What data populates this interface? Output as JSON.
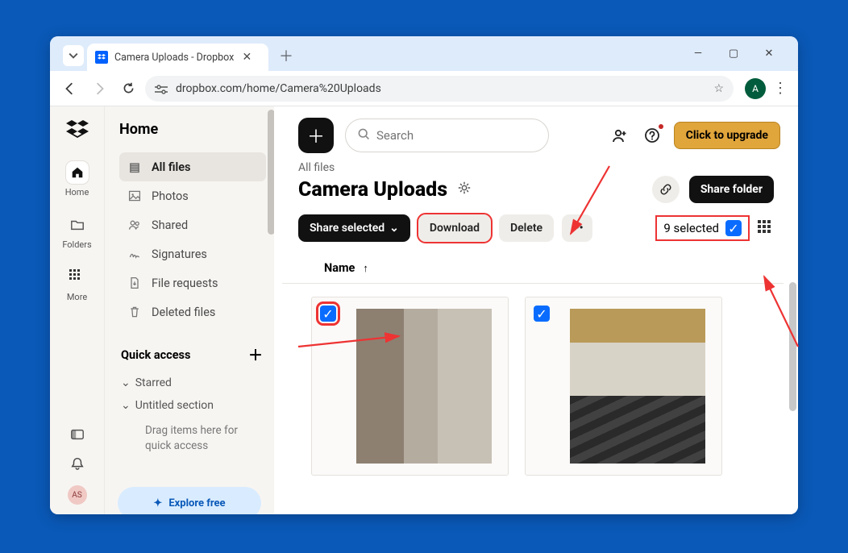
{
  "browser": {
    "tab_title": "Camera Uploads - Dropbox",
    "url": "dropbox.com/home/Camera%20Uploads",
    "profile_initial": "A"
  },
  "rail": {
    "items": [
      {
        "label": "Home"
      },
      {
        "label": "Folders"
      },
      {
        "label": "More"
      }
    ]
  },
  "sidebar": {
    "heading": "Home",
    "items": [
      {
        "label": "All files"
      },
      {
        "label": "Photos"
      },
      {
        "label": "Shared"
      },
      {
        "label": "Signatures"
      },
      {
        "label": "File requests"
      },
      {
        "label": "Deleted files"
      }
    ],
    "quick_access": "Quick access",
    "starred": "Starred",
    "untitled": "Untitled section",
    "drag_hint": "Drag items here for quick access",
    "explore": "Explore free",
    "avatar": "AS"
  },
  "main": {
    "search_placeholder": "Search",
    "upgrade": "Click to upgrade",
    "breadcrumb": "All files",
    "page_title": "Camera Uploads",
    "share_folder": "Share folder",
    "share_selected": "Share selected",
    "download": "Download",
    "delete": "Delete",
    "selected_text": "9 selected",
    "name_col": "Name"
  }
}
